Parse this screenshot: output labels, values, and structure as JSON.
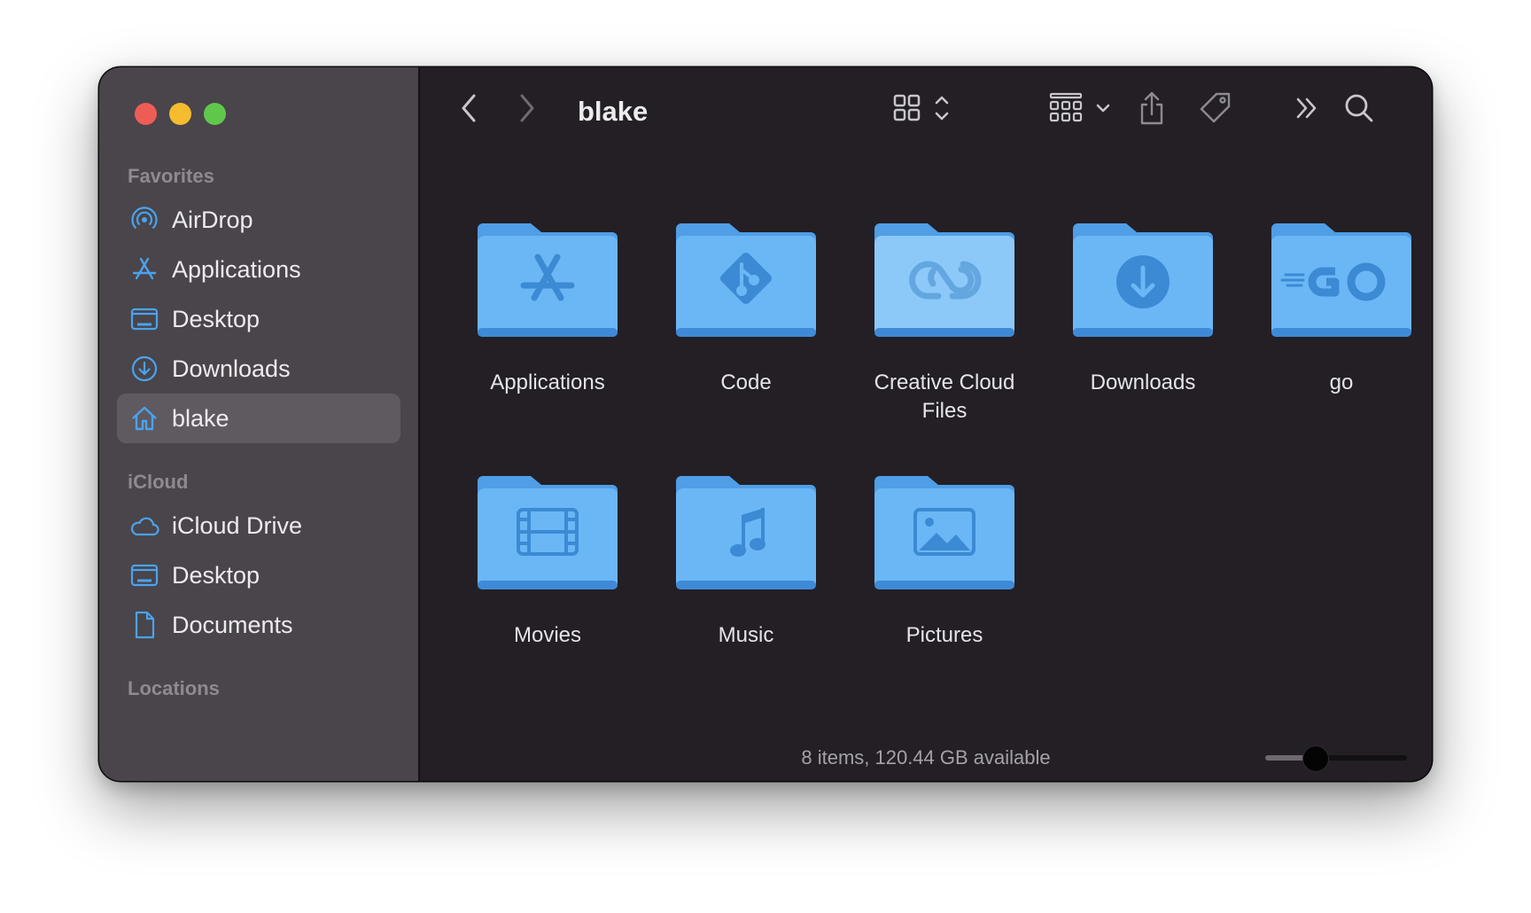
{
  "window": {
    "title": "blake"
  },
  "sidebar": {
    "sections": [
      {
        "title": "Favorites",
        "items": [
          {
            "label": "AirDrop",
            "icon": "airdrop-icon"
          },
          {
            "label": "Applications",
            "icon": "applications-icon"
          },
          {
            "label": "Desktop",
            "icon": "desktop-icon"
          },
          {
            "label": "Downloads",
            "icon": "downloads-icon"
          },
          {
            "label": "blake",
            "icon": "home-icon",
            "selected": true
          }
        ]
      },
      {
        "title": "iCloud",
        "items": [
          {
            "label": "iCloud Drive",
            "icon": "cloud-icon"
          },
          {
            "label": "Desktop",
            "icon": "desktop-icon"
          },
          {
            "label": "Documents",
            "icon": "document-icon"
          }
        ]
      },
      {
        "title": "Locations",
        "items": []
      }
    ]
  },
  "toolbar": {
    "back_icon": "chevron-left-icon",
    "forward_icon": "chevron-right-icon",
    "view_icon": "icon-grid-view-icon",
    "group_icon": "group-by-icon",
    "share_icon": "share-icon",
    "tag_icon": "tag-icon",
    "more_icon": "double-chevron-icon",
    "search_icon": "search-icon"
  },
  "items": [
    {
      "label": "Applications",
      "glyph": "app-store-icon"
    },
    {
      "label": "Code",
      "glyph": "git-icon"
    },
    {
      "label": "Creative Cloud Files",
      "glyph": "creative-cloud-icon"
    },
    {
      "label": "Downloads",
      "glyph": "download-icon"
    },
    {
      "label": "go",
      "glyph": "go-logo-icon"
    },
    {
      "label": "Movies",
      "glyph": "film-icon"
    },
    {
      "label": "Music",
      "glyph": "music-note-icon"
    },
    {
      "label": "Pictures",
      "glyph": "picture-icon"
    }
  ],
  "status": {
    "text": "8 items, 120.44 GB available"
  },
  "icon_size_slider": {
    "value": 0.35
  },
  "colors": {
    "accent": "#4aa3f0",
    "folder_body": "#6bb7f5",
    "folder_tab": "#4f9ee6",
    "folder_glyph": "#3c8ad4",
    "sidebar_bg": "#49454a",
    "main_bg": "#231f25"
  }
}
